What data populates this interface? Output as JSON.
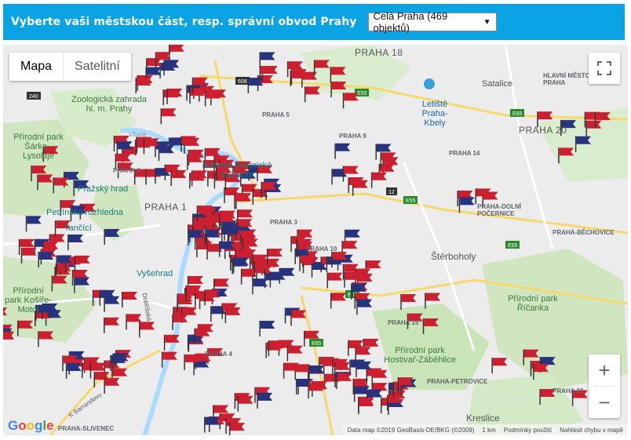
{
  "header": {
    "prompt": "Vyberte vaši městskou část, resp. správní obvod Prahy",
    "select_value": "Celá Praha (469 objektů)"
  },
  "map_controls": {
    "map_tab": "Mapa",
    "satellite_tab": "Satelitní",
    "zoom_in": "+",
    "zoom_out": "−"
  },
  "labels": {
    "praha18": "PRAHA 18",
    "praha20": "PRAHA 20",
    "praha14": "PRAHA 14",
    "praha1": "PRAHA 1",
    "praha3": "PRAHA 3",
    "praha4": "PRAHA 4",
    "praha5": "PRAHA 5",
    "praha6": "PRAHA 6",
    "praha9": "PRAHA 9",
    "praha10": "PRAHA 10",
    "praha15": "PRAHA 15",
    "praha22": "PRAHA 22",
    "praha_slivenec": "PRAHA-SLIVENEC",
    "praha_dolni_pocernice": "PRAHA-DOLNÍ POČERNICE",
    "praha_bechovice": "PRAHA-BĚCHOVICE",
    "praha_petrovice": "PRAHA-PETROVICE",
    "hlavni_mesto": "HLAVNÍ MĚSTO PRAHA",
    "satalice": "Satalice",
    "sterboholy": "Štěrboholy",
    "kreslice": "Kreslice",
    "zoo": "Zoologická zahrada hl. m. Prahy",
    "sarka": "Přírodní park Šárka - Lysolaje",
    "museum": "Národní technické muzeum",
    "hrad": "Pražský hrad",
    "petrin": "Petřínská rozhledna",
    "tancici": "Tančící",
    "vysehrad": "Vyšehrad",
    "kosire": "Přírodní park Košíře-Motol",
    "airport": "Letiště Praha-Kbely",
    "ricanka": "Přírodní park Říčanka",
    "hostivar": "Přírodní park Hostivař-Záběhlice",
    "vltava": "Vltava",
    "barrandovu": "K Barrandovu",
    "dobrisska": "Dobříšská"
  },
  "attribution": {
    "logo": "Google",
    "data": "Data map ©2019 GeoBasis-DE/BKG (©2009)",
    "scale": "1 km",
    "terms": "Podmínky použití",
    "report": "Nahlásit chybu v mapě"
  },
  "colors": {
    "accent": "#0aa3e3",
    "flag_red": "#cc1f2f",
    "flag_blue": "#27337e"
  }
}
